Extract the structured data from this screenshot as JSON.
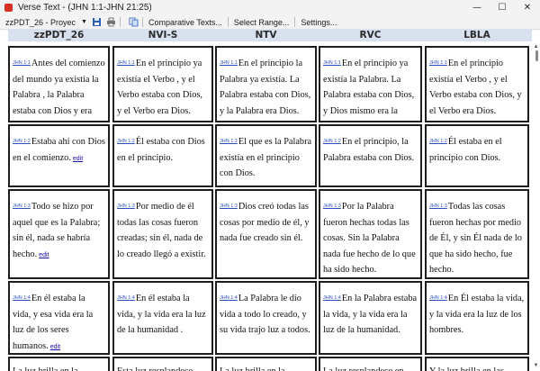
{
  "window": {
    "title": "Verse Text - (JHN 1:1-JHN 21:25)",
    "minimize": "—",
    "maximize": "☐",
    "close": "✕"
  },
  "toolbar": {
    "project": "zzPDT_26 - Proyec",
    "comparative": "Comparative Texts...",
    "select_range": "Select Range...",
    "settings": "Settings..."
  },
  "columns": [
    "zzPDT_26",
    "NVI-S",
    "NTV",
    "RVC",
    "LBLA"
  ],
  "edit_label": "edit",
  "rows": [
    {
      "cells": [
        {
          "ref": "JHN 1:1",
          "text": "Antes del comienzo del mundo ya existía la Palabra , la Palabra estaba con Dios y era Dios.",
          "edit": true
        },
        {
          "ref": "JHN 1:1",
          "text": "En el principio ya existía el Verbo , y el Verbo estaba con Dios, y el Verbo era Dios.",
          "edit": false
        },
        {
          "ref": "JHN 1:1",
          "text": "En el principio la Palabra ya existía. La Palabra estaba con Dios, y la Palabra era Dios.",
          "edit": false
        },
        {
          "ref": "JHN 1:1",
          "text": "En el principio ya existía la Palabra. La Palabra estaba con Dios, y Dios mismo era la Palabra.",
          "edit": false
        },
        {
          "ref": "JHN 1:1",
          "text": "En el principio existía el Verbo , y el Verbo estaba con Dios, y el Verbo era Dios.",
          "edit": false
        }
      ]
    },
    {
      "cells": [
        {
          "ref": "JHN 1:2",
          "text": "Estaba ahí con Dios en el comienzo.",
          "edit": true
        },
        {
          "ref": "JHN 1:2",
          "text": "Él estaba con Dios en el principio.",
          "edit": false
        },
        {
          "ref": "JHN 1:2",
          "text": "El que es la Palabra existía en el principio con Dios.",
          "edit": false
        },
        {
          "ref": "JHN 1:2",
          "text": "En el principio, la Palabra estaba con Dios.",
          "edit": false
        },
        {
          "ref": "JHN 1:2",
          "text": "Él estaba en el principio con Dios.",
          "edit": false
        }
      ]
    },
    {
      "cells": [
        {
          "ref": "JHN 1:3",
          "text": "Todo se hizo por aquel que es la Palabra; sin él, nada se habría hecho.",
          "edit": true
        },
        {
          "ref": "JHN 1:3",
          "text": "Por medio de él todas las cosas fueron creadas; sin él, nada de lo creado llegó a existir.",
          "edit": false
        },
        {
          "ref": "JHN 1:3",
          "text": "Dios creó todas las cosas por medio de él, y nada fue creado sin él.",
          "edit": false
        },
        {
          "ref": "JHN 1:3",
          "text": "Por la Palabra fueron hechas todas las cosas. Sin la Palabra nada fue hecho de lo que ha sido hecho.",
          "edit": false
        },
        {
          "ref": "JHN 1:3",
          "text": "Todas las cosas fueron hechas por medio de Él, y sin Él nada de lo que ha sido hecho, fue hecho.",
          "edit": false
        }
      ]
    },
    {
      "cells": [
        {
          "ref": "JHN 1:4",
          "text": "En él estaba la vida, y esa vida era la luz de los seres humanos.",
          "edit": true
        },
        {
          "ref": "JHN 1:4",
          "text": "En él estaba la vida, y la vida era la luz de la humanidad .",
          "edit": false
        },
        {
          "ref": "JHN 1:4",
          "text": "La Palabra le dio vida a todo lo creado, y su vida trajo luz a todos.",
          "edit": false
        },
        {
          "ref": "JHN 1:4",
          "text": "En la Palabra estaba la vida, y la vida era la luz de la humanidad.",
          "edit": false
        },
        {
          "ref": "JHN 1:4",
          "text": "En Él estaba la vida, y la vida era la luz de los hombres.",
          "edit": false
        }
      ]
    },
    {
      "cells": [
        {
          "ref": "",
          "text": "La luz brilla en la",
          "edit": false
        },
        {
          "ref": "",
          "text": "Esta luz resplandece",
          "edit": false
        },
        {
          "ref": "",
          "text": "La luz brilla en la",
          "edit": false
        },
        {
          "ref": "",
          "text": "La luz resplandece en",
          "edit": false
        },
        {
          "ref": "",
          "text": "Y la luz brilla en las",
          "edit": false
        }
      ]
    }
  ]
}
